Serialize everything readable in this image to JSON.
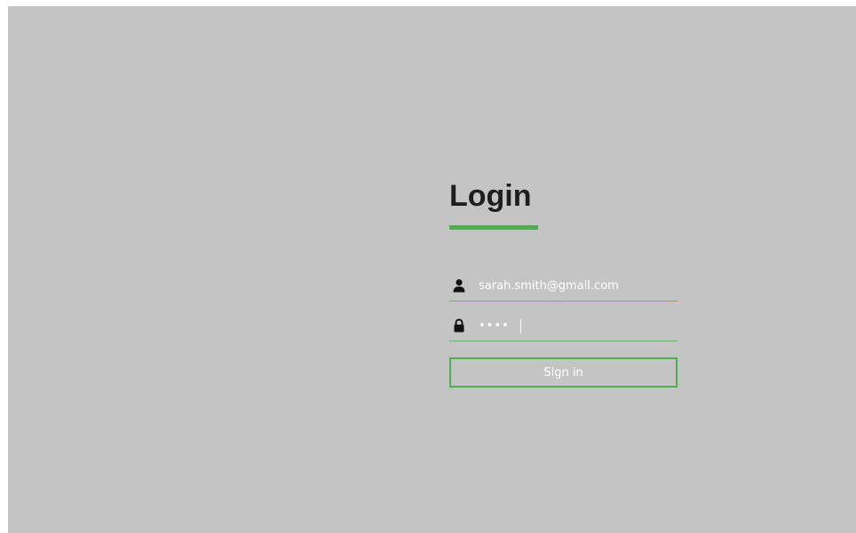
{
  "login": {
    "title": "Login",
    "email": {
      "value": "sarah.smith@gmail.com",
      "icon": "user-icon"
    },
    "password": {
      "value": "••••",
      "icon": "lock-icon"
    },
    "signin_label": "Sign in"
  },
  "colors": {
    "background": "#c4c4c4",
    "accent": "#4cae4f",
    "field_line": "#63b866",
    "text_dark": "#1e1e1e",
    "text_light": "#ffffff"
  }
}
